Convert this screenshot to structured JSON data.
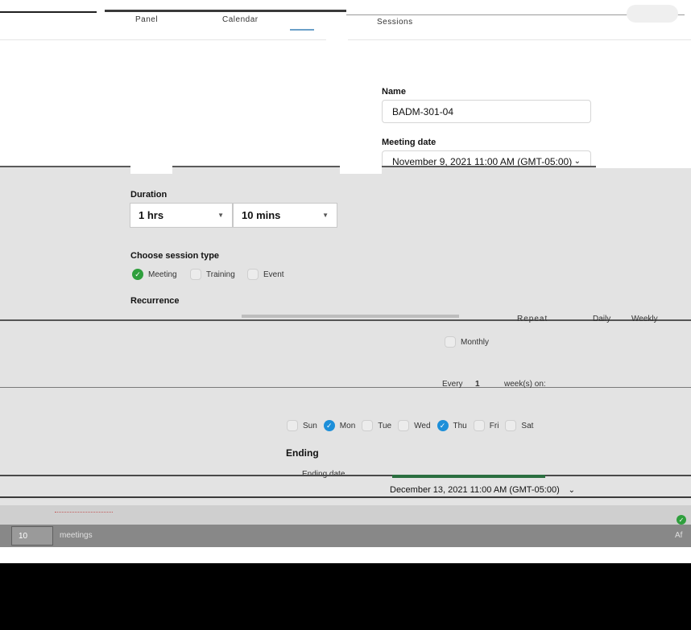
{
  "header": {
    "text_a": "Panel",
    "text_b": "Calendar",
    "text_c": "Sessions"
  },
  "form": {
    "name_label": "Name",
    "name_value": "BADM-301-04",
    "date_label": "Meeting date",
    "date_value": "November 9, 2021 11:00 AM (GMT-05:00)",
    "duration_label": "Duration",
    "duration_hours": "1 hrs",
    "duration_minutes": "10 mins",
    "session_type_label": "Choose session type",
    "session_types": [
      "Meeting",
      "Training",
      "Event"
    ],
    "session_type_selected": "Meeting",
    "recurrence_label": "Recurrence",
    "repeat_label": "Repeat",
    "repeat_options": [
      "Daily",
      "Weekly",
      "Monthly"
    ],
    "repeat_selected": "Weekly",
    "every_label": "Every",
    "every_value": "1",
    "every_unit": "week(s) on:",
    "weekdays": [
      "Sun",
      "Mon",
      "Tue",
      "Wed",
      "Thu",
      "Fri",
      "Sat"
    ],
    "weekdays_selected": [
      "Mon",
      "Thu"
    ],
    "ending_label": "Ending",
    "ending_date_label": "Ending date",
    "ending_date_value": "December 13, 2021 11:00 AM (GMT-05:00)",
    "after_value": "10",
    "after_unit": "meetings",
    "after_label": "Af"
  },
  "colors": {
    "check_green": "#2f9f3d",
    "check_blue": "#1d8fd9",
    "band_gray": "#e3e3e3"
  }
}
